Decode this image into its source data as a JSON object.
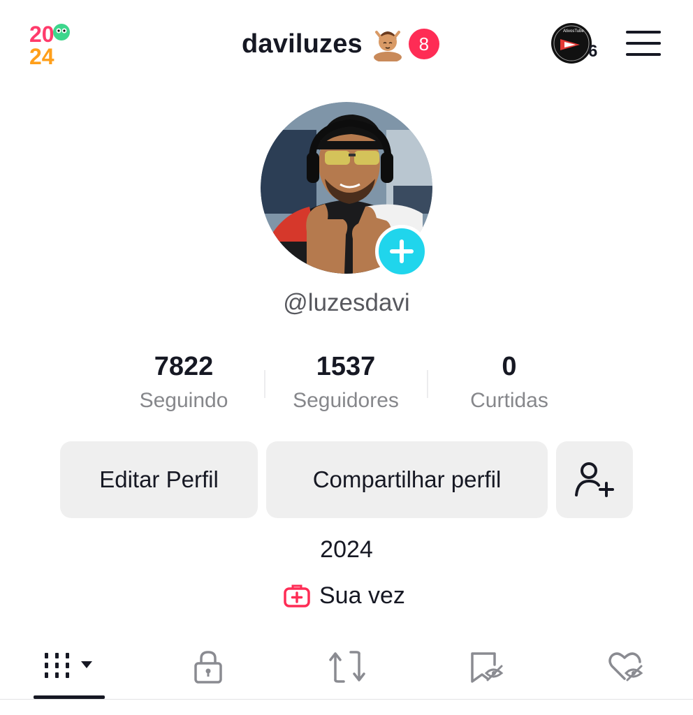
{
  "header": {
    "title": "daviluzes",
    "notification_count": "8",
    "live_badge_text": "AtivosTube",
    "live_count": "6",
    "logo_text_top": "20",
    "logo_text_bottom": "24",
    "icons": [
      "2024-logo-icon",
      "emoji-avatar-icon",
      "live-badge-icon",
      "menu-icon"
    ]
  },
  "profile": {
    "handle": "@luzesdavi",
    "stats": [
      {
        "value": "7822",
        "label": "Seguindo"
      },
      {
        "value": "1537",
        "label": "Seguidores"
      },
      {
        "value": "0",
        "label": "Curtidas"
      }
    ],
    "buttons": {
      "edit": "Editar Perfil",
      "share": "Compartilhar perfil"
    },
    "bio": "2024",
    "link_label": "Sua vez"
  },
  "tabs": [
    {
      "name": "videos-grid",
      "icon": "grid-icon",
      "active": true
    },
    {
      "name": "private",
      "icon": "lock-icon",
      "active": false
    },
    {
      "name": "reposts",
      "icon": "repost-icon",
      "active": false
    },
    {
      "name": "favorites",
      "icon": "bookmark-hidden-icon",
      "active": false
    },
    {
      "name": "liked",
      "icon": "heart-hidden-icon",
      "active": false
    }
  ],
  "colors": {
    "accent_red": "#fe2c55",
    "add_button_cyan": "#20d5ec",
    "button_bg": "#efefef",
    "text_primary": "#161823",
    "text_secondary": "#86878b"
  }
}
